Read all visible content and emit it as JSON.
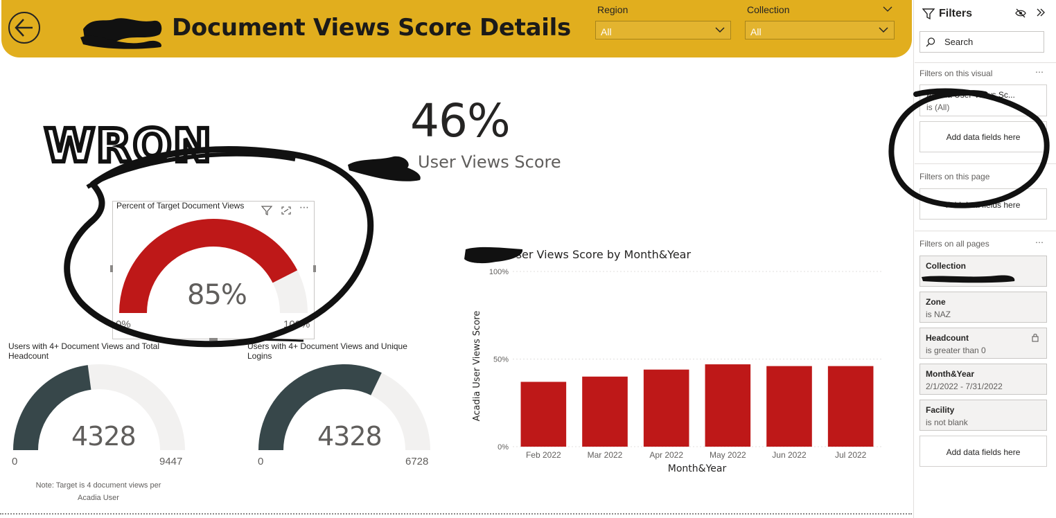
{
  "header": {
    "title": "Document Views Score Details",
    "colors": {
      "header_bg": "#E1AE1E"
    },
    "back_icon": "arrow-left-circle-icon",
    "slicers": [
      {
        "label": "Region",
        "value": "All"
      },
      {
        "label": "Collection",
        "value": "All"
      }
    ]
  },
  "kpi": {
    "value": "46%",
    "label": "User Views Score"
  },
  "annotation": {
    "text": "WRONG"
  },
  "target_gauge": {
    "title": "Percent of Target Document Views",
    "value_text": "85%",
    "min": "0%",
    "max": "100%",
    "fraction": 0.85,
    "color": "#BE1818"
  },
  "gauge_headcount": {
    "title_line1": "Users with 4+ Document Views and Total",
    "title_line2": "Headcount",
    "value_text": "4328",
    "min": "0",
    "max": "9447",
    "fraction": 0.458,
    "color": "#37474A"
  },
  "gauge_logins": {
    "title_line1": "Users with 4+ Document Views and Unique",
    "title_line2": "Logins",
    "value_text": "4328",
    "min": "0",
    "max": "6728",
    "fraction": 0.643,
    "color": "#37474A"
  },
  "note": {
    "line1": "Note: Target is 4 document views per",
    "line2": "Acadia User"
  },
  "chart_data": {
    "type": "bar",
    "title": "User Views Score by Month&Year",
    "xlabel": "Month&Year",
    "ylabel": "Acadia User Views Score",
    "categories": [
      "Feb 2022",
      "Mar 2022",
      "Apr 2022",
      "May 2022",
      "Jun 2022",
      "Jul 2022"
    ],
    "values": [
      37,
      40,
      44,
      47,
      46,
      46
    ],
    "ylim": [
      0,
      100
    ],
    "yticks": [
      "0%",
      "50%",
      "100%"
    ],
    "color": "#BE1818",
    "grid": true
  },
  "filters": {
    "title": "Filters",
    "search_placeholder": "Search",
    "section_visual": "Filters on this visual",
    "visual_card": {
      "title": "Acadia User Views Sc...",
      "sub": "is (All)"
    },
    "add_fields": "Add data fields here",
    "section_page": "Filters on this page",
    "page_add": "Add data fields here",
    "section_all": "Filters on all pages",
    "more": "...",
    "cards": [
      {
        "title": "Collection",
        "sub": ""
      },
      {
        "title": "Zone",
        "sub": "is NAZ"
      },
      {
        "title": "Headcount",
        "sub": "is greater than 0"
      },
      {
        "title": "Month&Year",
        "sub": "2/1/2022 - 7/31/2022"
      },
      {
        "title": "Facility",
        "sub": "is not blank"
      }
    ],
    "all_add": "Add data fields here"
  }
}
